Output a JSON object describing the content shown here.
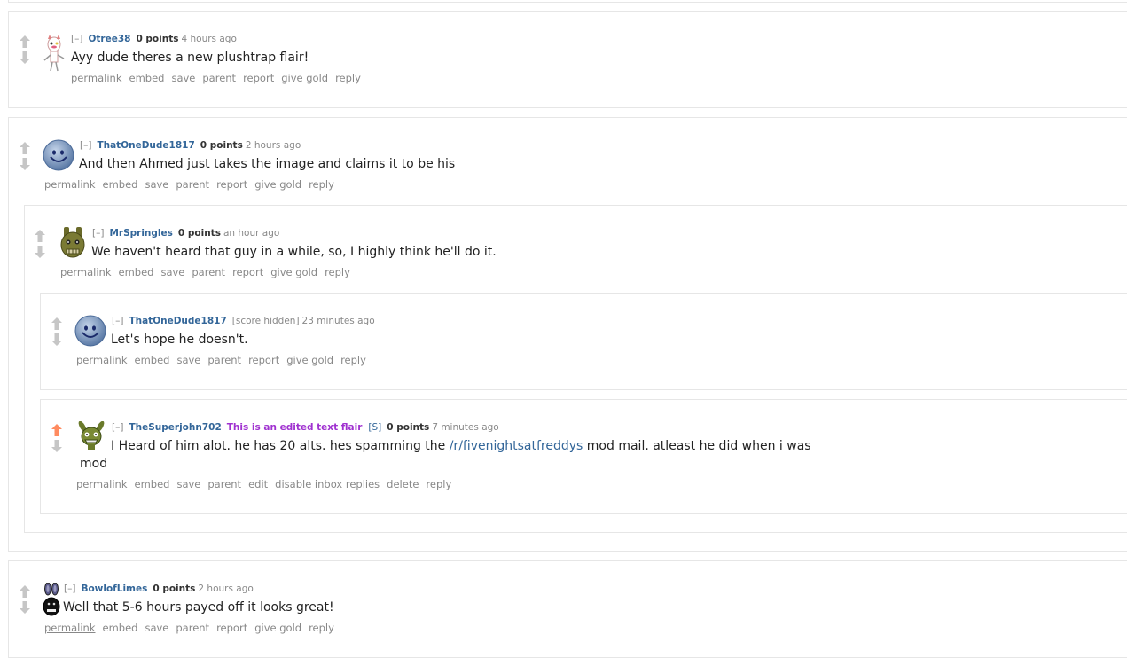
{
  "collapse": "[–]",
  "ago": "ago",
  "comments": {
    "c1": {
      "author": "Otree38",
      "points": "0 points",
      "time": "4 hours",
      "body": "Ayy dude theres a new plushtrap flair!",
      "buttons": [
        "permalink",
        "embed",
        "save",
        "parent",
        "report",
        "give gold",
        "reply"
      ]
    },
    "c2": {
      "author": "ThatOneDude1817",
      "points": "0 points",
      "time": "2 hours",
      "body": "And then Ahmed just takes the image and claims it to be his",
      "buttons": [
        "permalink",
        "embed",
        "save",
        "parent",
        "report",
        "give gold",
        "reply"
      ]
    },
    "c3": {
      "author": "MrSpringles",
      "points": "0 points",
      "time": "an hour",
      "body": "We haven't heard that guy in a while, so, I highly think he'll do it.",
      "buttons": [
        "permalink",
        "embed",
        "save",
        "parent",
        "report",
        "give gold",
        "reply"
      ]
    },
    "c4": {
      "author": "ThatOneDude1817",
      "points": "[score hidden]",
      "time": "23 minutes",
      "body": "Let's hope he doesn't.",
      "buttons": [
        "permalink",
        "embed",
        "save",
        "parent",
        "report",
        "give gold",
        "reply"
      ]
    },
    "c5": {
      "author": "TheSuperjohn702",
      "flair": "This is an edited text flair",
      "submitter": "[S]",
      "points": "0 points",
      "time": "7 minutes",
      "body_before": "I Heard of him alot. he has 20 alts. hes spamming the ",
      "body_link": "/r/fivenightsatfreddys",
      "body_after": " mod mail. atleast he did when i was",
      "body_line2": "mod",
      "buttons": [
        "permalink",
        "embed",
        "save",
        "parent",
        "edit",
        "disable inbox replies",
        "delete",
        "reply"
      ]
    },
    "c6": {
      "author": "BowlofLimes",
      "points": "0 points",
      "time": "2 hours",
      "body": "Well that 5-6 hours payed off it looks great!",
      "buttons": [
        "permalink",
        "embed",
        "save",
        "parent",
        "report",
        "give gold",
        "reply"
      ]
    }
  },
  "colors": {
    "upvoted": "#ff8b60",
    "arrow": "#c6c6c6",
    "author": "#336699",
    "flair": "#a032d0"
  }
}
